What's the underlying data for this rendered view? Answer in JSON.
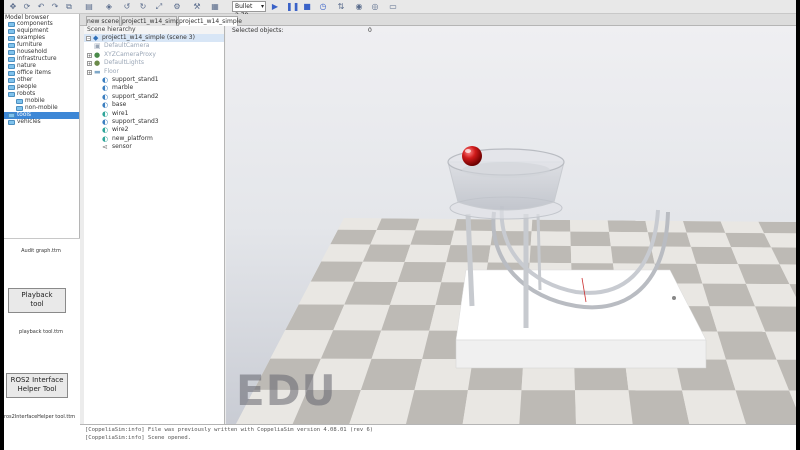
{
  "toolbar": {
    "selection_value": "Bullet 2.78",
    "icons": [
      "move-icon",
      "rotate-icon",
      "undo-icon",
      "redo-icon",
      "copy-icon",
      "paste-icon",
      "select-icon",
      "scale-icon",
      "assembly-icon",
      "settings-icon",
      "play-icon",
      "pause-icon",
      "stop-icon",
      "realtime-icon",
      "thread-icon",
      "camera-icon",
      "eye-icon",
      "lock-icon"
    ]
  },
  "model_browser": {
    "title": "Model browser",
    "items": [
      {
        "label": "components",
        "level": 1
      },
      {
        "label": "equipment",
        "level": 1
      },
      {
        "label": "examples",
        "level": 1
      },
      {
        "label": "furniture",
        "level": 1
      },
      {
        "label": "household",
        "level": 1
      },
      {
        "label": "infrastructure",
        "level": 1
      },
      {
        "label": "nature",
        "level": 1
      },
      {
        "label": "office items",
        "level": 1
      },
      {
        "label": "other",
        "level": 1
      },
      {
        "label": "people",
        "level": 1
      },
      {
        "label": "robots",
        "level": 1
      },
      {
        "label": "mobile",
        "level": 2
      },
      {
        "label": "non-mobile",
        "level": 2
      },
      {
        "label": "tools",
        "level": 1,
        "selected": true
      },
      {
        "label": "vehicles",
        "level": 1
      }
    ],
    "tools": [
      {
        "caption_top": "Audit graph.ttm",
        "label_line1": "Playback",
        "label_line2": "tool",
        "caption_bottom": "playback tool.ttm"
      },
      {
        "label_line1": "ROS2 Interface",
        "label_line2": "Helper Tool",
        "caption_bottom": "ros2InterfaceHelper tool.ttm"
      }
    ]
  },
  "tabs": [
    "new scene",
    "project1_w14_simple",
    "project1_w14_simple"
  ],
  "scene_hierarchy": {
    "title": "Scene hierarchy",
    "root": "project1_w14_simple (scene 3)",
    "items": [
      {
        "label": "DefaultCamera",
        "faded": true,
        "icon": "camera-icon"
      },
      {
        "label": "XYZCameraProxy",
        "faded": true,
        "icon": "camera-proxy-icon",
        "expand": true
      },
      {
        "label": "DefaultLights",
        "faded": true,
        "icon": "light-icon",
        "expand": true
      },
      {
        "label": "Floor",
        "faded": true,
        "icon": "floor-icon",
        "expand": true
      },
      {
        "label": "support_stand1",
        "icon": "shape-icon"
      },
      {
        "label": "marble",
        "icon": "shape-icon"
      },
      {
        "label": "support_stand2",
        "icon": "shape-icon"
      },
      {
        "label": "base",
        "icon": "shape-icon"
      },
      {
        "label": "wire1",
        "icon": "shape-icon"
      },
      {
        "label": "support_stand3",
        "icon": "shape-icon"
      },
      {
        "label": "wire2",
        "icon": "shape-icon"
      },
      {
        "label": "new_platform",
        "icon": "shape-icon"
      },
      {
        "label": "sensor",
        "icon": "sensor-icon"
      }
    ]
  },
  "viewport": {
    "selected_label": "Selected objects:",
    "selected_count": "0",
    "watermark": "EDU"
  },
  "console": {
    "lines": [
      "[CoppeliaSim:info] File was previously written with CoppeliaSim version 4.08.01 (rev 6)",
      "[CoppeliaSim:info] Scene opened."
    ]
  },
  "colors": {
    "selection": "#3d87d6",
    "marble": "#d01a1a",
    "folder": "#7fc2ec",
    "floor_light": "#e9e7e3",
    "floor_dark": "#bdbab5"
  }
}
